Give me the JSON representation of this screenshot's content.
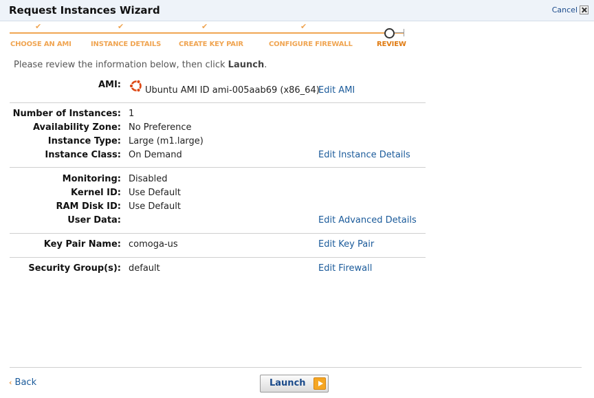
{
  "window": {
    "title": "Request Instances Wizard",
    "cancel_label": "Cancel"
  },
  "wizard": {
    "steps": [
      {
        "label": "CHOOSE AN AMI",
        "status": "done"
      },
      {
        "label": "INSTANCE DETAILS",
        "status": "done"
      },
      {
        "label": "CREATE KEY PAIR",
        "status": "done"
      },
      {
        "label": "CONFIGURE FIREWALL",
        "status": "done"
      },
      {
        "label": "REVIEW",
        "status": "current"
      }
    ],
    "check_mark": "✔"
  },
  "intro": {
    "text": "Please review the information below, then click ",
    "action": "Launch",
    "suffix": "."
  },
  "review": {
    "ami": {
      "label": "AMI:",
      "value": "Ubuntu AMI ID ami-005aab69 (x86_64)",
      "edit": "Edit AMI",
      "icon": "ubuntu-logo-icon"
    },
    "instance_details": {
      "rows": [
        {
          "label": "Number of Instances:",
          "value": "1"
        },
        {
          "label": "Availability Zone:",
          "value": "No Preference"
        },
        {
          "label": "Instance Type:",
          "value": "Large (m1.large)"
        },
        {
          "label": "Instance Class:",
          "value": "On Demand"
        }
      ],
      "edit": "Edit Instance Details"
    },
    "advanced": {
      "rows": [
        {
          "label": "Monitoring:",
          "value": "Disabled"
        },
        {
          "label": "Kernel ID:",
          "value": "Use Default"
        },
        {
          "label": "RAM Disk ID:",
          "value": "Use Default"
        },
        {
          "label": "User Data:",
          "value": ""
        }
      ],
      "edit": "Edit Advanced Details"
    },
    "key_pair": {
      "label": "Key Pair Name:",
      "value": "comoga-us",
      "edit": "Edit Key Pair"
    },
    "firewall": {
      "label": "Security Group(s):",
      "value": "default",
      "edit": "Edit Firewall"
    }
  },
  "footer": {
    "back_chevron": "‹",
    "back_label": "Back",
    "launch_label": "Launch"
  },
  "colors": {
    "accent": "#f0a552",
    "link": "#1a5a9a",
    "launch_arrow": "#f5a623"
  }
}
